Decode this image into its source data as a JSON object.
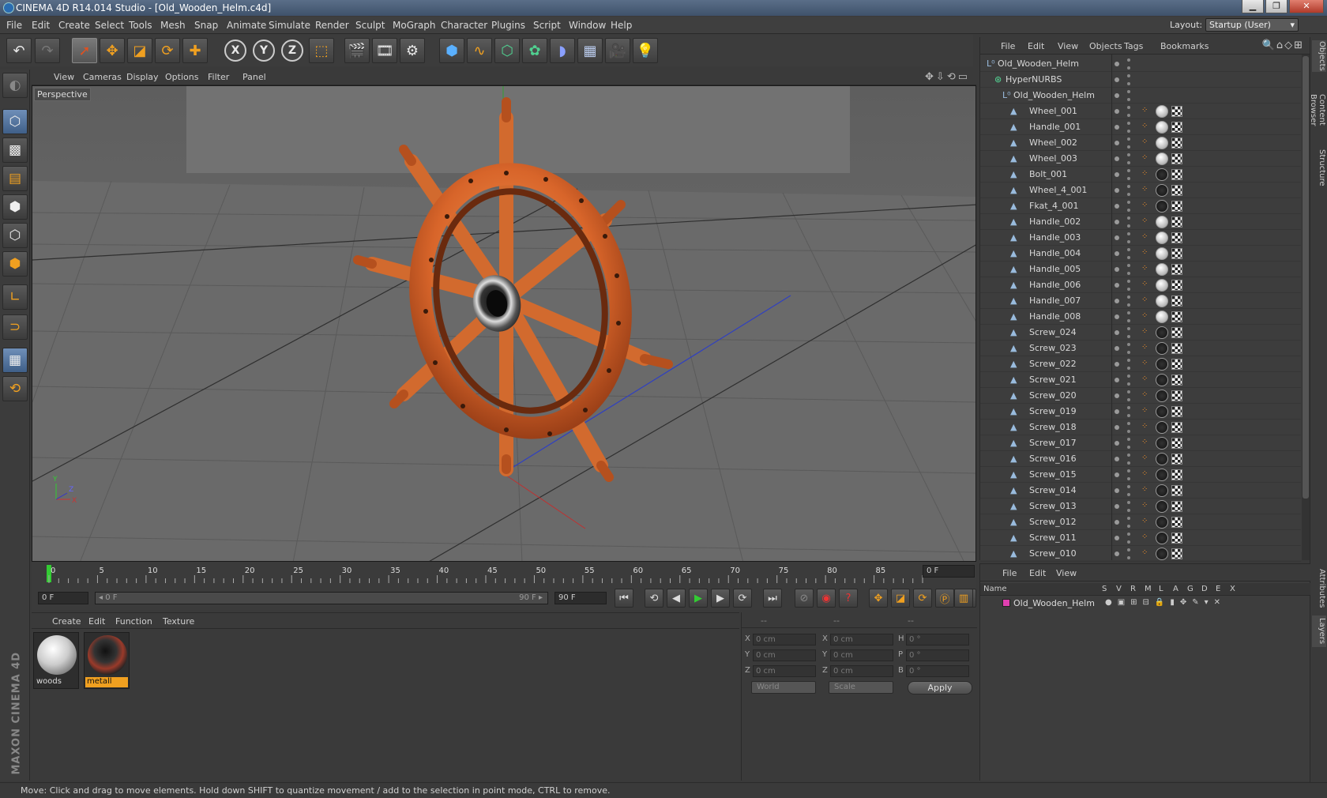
{
  "window": {
    "title": "CINEMA 4D R14.014 Studio - [Old_Wooden_Helm.c4d]",
    "buttons": [
      "▁",
      "❐",
      "✕"
    ]
  },
  "menu": [
    "File",
    "Edit",
    "Create",
    "Select",
    "Tools",
    "Mesh",
    "Snap",
    "Animate",
    "Simulate",
    "Render",
    "Sculpt",
    "MoGraph",
    "Character",
    "Plugins",
    "Script",
    "Window",
    "Help"
  ],
  "layout": {
    "label": "Layout:",
    "value": "Startup (User)"
  },
  "viewport": {
    "menu": [
      "View",
      "Cameras",
      "Display",
      "Options",
      "Filter",
      "Panel"
    ],
    "label": "Perspective",
    "axis": {
      "y": "Y",
      "z": "Z",
      "x": "X"
    }
  },
  "timeline": {
    "ticks": [
      "0",
      "5",
      "10",
      "15",
      "20",
      "25",
      "30",
      "35",
      "40",
      "45",
      "50",
      "55",
      "60",
      "65",
      "70",
      "75",
      "80",
      "85",
      "90"
    ],
    "current": "0 F",
    "start": "0 F",
    "range_start": "◂ 0 F",
    "range_end": "90 F ▸",
    "end": "90 F"
  },
  "material_panel": {
    "menu": [
      "Create",
      "Edit",
      "Function",
      "Texture"
    ],
    "materials": [
      {
        "name": "woods",
        "selected": false
      },
      {
        "name": "metall",
        "selected": true
      }
    ]
  },
  "coords": {
    "header": [
      "--",
      "--",
      "--"
    ],
    "rows": [
      {
        "l1": "X",
        "v1": "0 cm",
        "l2": "X",
        "v2": "0 cm",
        "l3": "H",
        "v3": "0 °"
      },
      {
        "l1": "Y",
        "v1": "0 cm",
        "l2": "Y",
        "v2": "0 cm",
        "l3": "P",
        "v3": "0 °"
      },
      {
        "l1": "Z",
        "v1": "0 cm",
        "l2": "Z",
        "v2": "0 cm",
        "l3": "B",
        "v3": "0 °"
      }
    ],
    "space": "World",
    "mode": "Scale",
    "apply": "Apply"
  },
  "object_manager": {
    "menu": [
      "File",
      "Edit",
      "View",
      "Objects",
      "Tags",
      "Bookmarks"
    ],
    "tree": [
      {
        "name": "Old_Wooden_Helm",
        "indent": 0,
        "type": "null"
      },
      {
        "name": "HyperNURBS",
        "indent": 1,
        "type": "nurbs"
      },
      {
        "name": "Old_Wooden_Helm",
        "indent": 2,
        "type": "null"
      }
    ],
    "objects": [
      "Wheel_001",
      "Handle_001",
      "Wheel_002",
      "Wheel_003",
      "Bolt_001",
      "Wheel_4_001",
      "Fkat_4_001",
      "Handle_002",
      "Handle_003",
      "Handle_004",
      "Handle_005",
      "Handle_006",
      "Handle_007",
      "Handle_008",
      "Screw_024",
      "Screw_023",
      "Screw_022",
      "Screw_021",
      "Screw_020",
      "Screw_019",
      "Screw_018",
      "Screw_017",
      "Screw_016",
      "Screw_015",
      "Screw_014",
      "Screw_013",
      "Screw_012",
      "Screw_011",
      "Screw_010"
    ]
  },
  "side_tabs": [
    "Objects",
    "Content Browser",
    "Structure",
    "Attributes",
    "Layers"
  ],
  "layer_manager": {
    "menu": [
      "File",
      "Edit",
      "View"
    ],
    "columns": [
      "Name",
      "S",
      "V",
      "R",
      "M",
      "L",
      "A",
      "G",
      "D",
      "E",
      "X"
    ],
    "layer": "Old_Wooden_Helm"
  },
  "status": "Move: Click and drag to move elements. Hold down SHIFT to quantize movement / add to the selection in point mode, CTRL to remove.",
  "logo": "MAXON CINEMA 4D"
}
